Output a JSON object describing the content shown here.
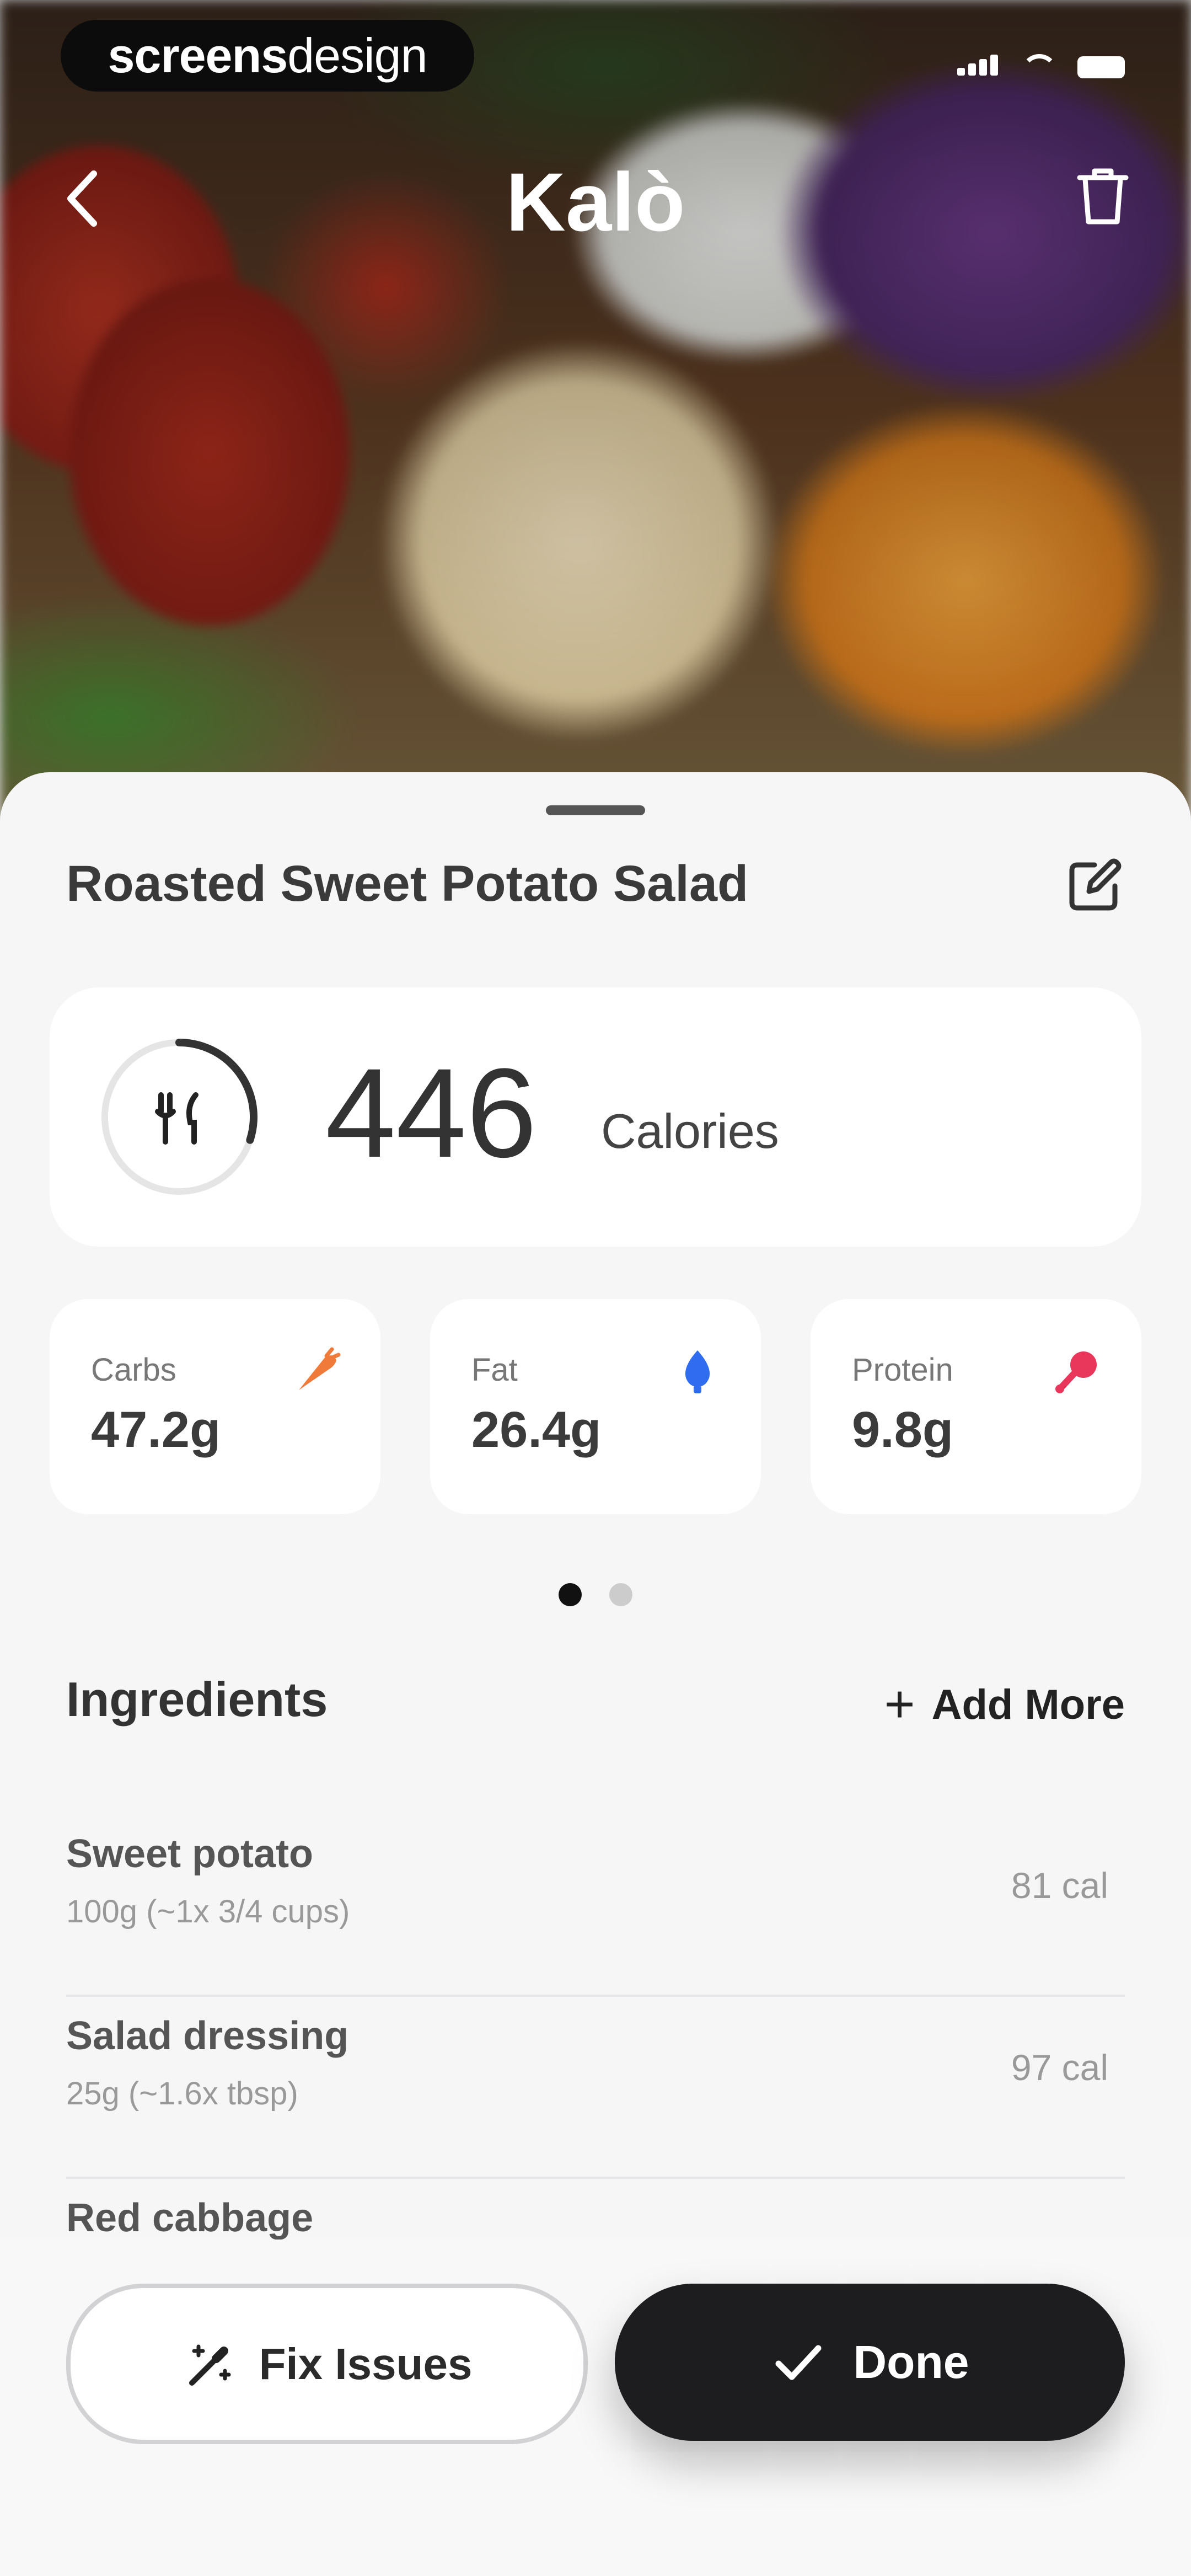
{
  "watermark": {
    "brand_bold": "screens",
    "brand_light": "design"
  },
  "nav": {
    "title": "Kalò",
    "back_icon": "chevron-left-icon",
    "delete_icon": "trash-icon"
  },
  "meal": {
    "title": "Roasted Sweet Potato Salad",
    "edit_icon": "edit-icon"
  },
  "calories": {
    "value": "446",
    "label": "Calories",
    "progress_fraction": 0.3,
    "icon": "fork-knife-icon"
  },
  "macros": [
    {
      "label": "Carbs",
      "value": "47.2g",
      "icon": "carrot-icon",
      "color": "#f07a3a"
    },
    {
      "label": "Fat",
      "value": "26.4g",
      "icon": "drop-icon",
      "color": "#2f6cf0"
    },
    {
      "label": "Protein",
      "value": "9.8g",
      "icon": "drumstick-icon",
      "color": "#e8375a"
    }
  ],
  "pager": {
    "count": 2,
    "active": 0
  },
  "ingredients": {
    "title": "Ingredients",
    "add_more_label": "Add More",
    "items": [
      {
        "name": "Sweet potato",
        "amount": "100g (~1x 3/4 cups)",
        "calories": "81 cal"
      },
      {
        "name": "Salad dressing",
        "amount": "25g (~1.6x tbsp)",
        "calories": "97 cal"
      },
      {
        "name": "Red cabbage",
        "amount": "",
        "calories": ""
      }
    ]
  },
  "actions": {
    "fix_label": "Fix Issues",
    "done_label": "Done"
  }
}
